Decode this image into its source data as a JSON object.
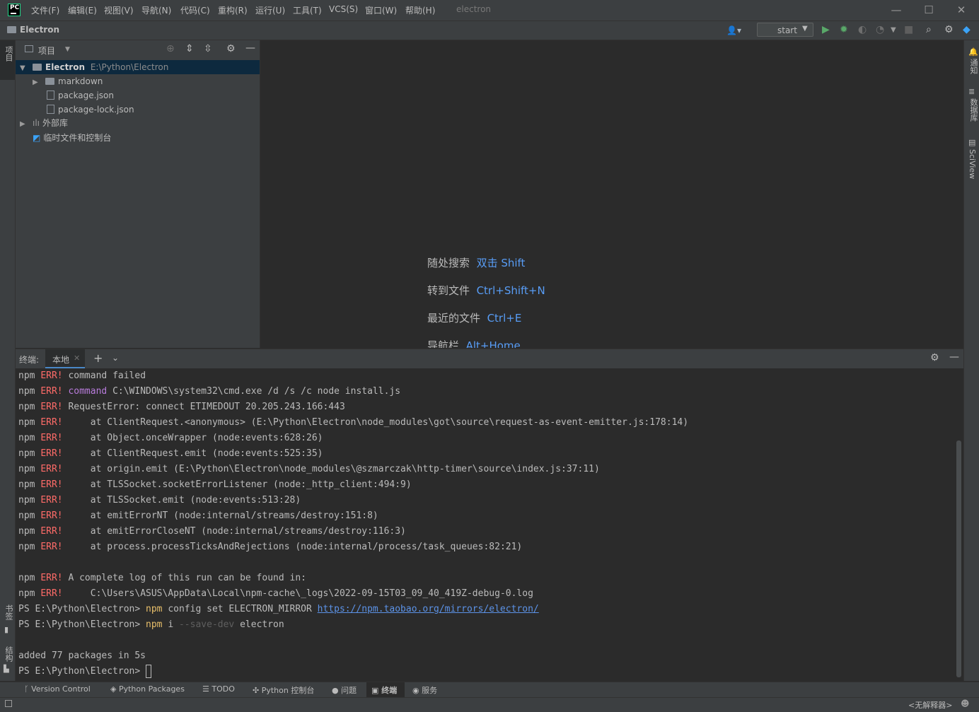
{
  "title_bar": {
    "logo_text": "PC",
    "menu": [
      "文件(F)",
      "编辑(E)",
      "视图(V)",
      "导航(N)",
      "代码(C)",
      "重构(R)",
      "运行(U)",
      "工具(T)",
      "VCS(S)",
      "窗口(W)",
      "帮助(H)"
    ],
    "window_title": "electron"
  },
  "nav_bar": {
    "project_name": "Electron",
    "run_config": "start"
  },
  "left_stripe": {
    "project_tab": "项目",
    "bookmarks_tab": "书签",
    "structure_tab": "结构"
  },
  "right_stripe": {
    "notifications_tab": "通知",
    "database_tab": "数据库",
    "sciview_tab": "SciView"
  },
  "project_panel": {
    "header_label": "项目",
    "root_name": "Electron",
    "root_path": "E:\\Python\\Electron",
    "items": [
      "markdown",
      "package.json",
      "package-lock.json",
      "外部库",
      "临时文件和控制台"
    ]
  },
  "editor_hints": [
    {
      "label": "随处搜索",
      "key": "双击 Shift"
    },
    {
      "label": "转到文件",
      "key": "Ctrl+Shift+N"
    },
    {
      "label": "最近的文件",
      "key": "Ctrl+E"
    },
    {
      "label": "导航栏",
      "key": "Alt+Home"
    }
  ],
  "terminal": {
    "title": "终端:",
    "tab": "本地",
    "lines": [
      {
        "pre": "npm ",
        "err": "ERR!",
        "mid": " ",
        "cmd": "",
        "rest": "command failed"
      },
      {
        "pre": "npm ",
        "err": "ERR!",
        "mid": " ",
        "cmd": "command",
        "rest": " C:\\WINDOWS\\system32\\cmd.exe /d /s /c node install.js"
      },
      {
        "pre": "npm ",
        "err": "ERR!",
        "mid": " ",
        "cmd": "",
        "rest": "RequestError: connect ETIMEDOUT 20.205.243.166:443"
      },
      {
        "pre": "npm ",
        "err": "ERR!",
        "mid": "     ",
        "cmd": "",
        "rest": "at ClientRequest.<anonymous> (E:\\Python\\Electron\\node_modules\\got\\source\\request-as-event-emitter.js:178:14)"
      },
      {
        "pre": "npm ",
        "err": "ERR!",
        "mid": "     ",
        "cmd": "",
        "rest": "at Object.onceWrapper (node:events:628:26)"
      },
      {
        "pre": "npm ",
        "err": "ERR!",
        "mid": "     ",
        "cmd": "",
        "rest": "at ClientRequest.emit (node:events:525:35)"
      },
      {
        "pre": "npm ",
        "err": "ERR!",
        "mid": "     ",
        "cmd": "",
        "rest": "at origin.emit (E:\\Python\\Electron\\node_modules\\@szmarczak\\http-timer\\source\\index.js:37:11)"
      },
      {
        "pre": "npm ",
        "err": "ERR!",
        "mid": "     ",
        "cmd": "",
        "rest": "at TLSSocket.socketErrorListener (node:_http_client:494:9)"
      },
      {
        "pre": "npm ",
        "err": "ERR!",
        "mid": "     ",
        "cmd": "",
        "rest": "at TLSSocket.emit (node:events:513:28)"
      },
      {
        "pre": "npm ",
        "err": "ERR!",
        "mid": "     ",
        "cmd": "",
        "rest": "at emitErrorNT (node:internal/streams/destroy:151:8)"
      },
      {
        "pre": "npm ",
        "err": "ERR!",
        "mid": "     ",
        "cmd": "",
        "rest": "at emitErrorCloseNT (node:internal/streams/destroy:116:3)"
      },
      {
        "pre": "npm ",
        "err": "ERR!",
        "mid": "     ",
        "cmd": "",
        "rest": "at process.processTicksAndRejections (node:internal/process/task_queues:82:21)"
      },
      {
        "pre": "",
        "err": "",
        "mid": "",
        "cmd": "",
        "rest": ""
      },
      {
        "pre": "npm ",
        "err": "ERR!",
        "mid": " ",
        "cmd": "",
        "rest": "A complete log of this run can be found in:"
      },
      {
        "pre": "npm ",
        "err": "ERR!",
        "mid": "     ",
        "cmd": "",
        "rest": "C:\\Users\\ASUS\\AppData\\Local\\npm-cache\\_logs\\2022-09-15T03_09_40_419Z-debug-0.log"
      }
    ],
    "prompt": "PS E:\\Python\\Electron> ",
    "cmd1_npm": "npm",
    "cmd1_rest": " config set ELECTRON_MIRROR ",
    "cmd1_url": "https://npm.taobao.org/mirrors/electron/",
    "cmd2_npm": "npm",
    "cmd2_i": " i ",
    "cmd2_flag": "--save-dev",
    "cmd2_pkg": " electron",
    "result": "added 77 packages in 5s"
  },
  "tool_windows": [
    "Version Control",
    "Python Packages",
    "TODO",
    "Python 控制台",
    "问题",
    "终端",
    "服务"
  ],
  "status_bar": {
    "interpreter": "<无解释器>"
  },
  "colors": {
    "accent_link": "#589df6",
    "error": "#ff6b68",
    "npm": "#e8bf6a",
    "run_green": "#59a869"
  }
}
